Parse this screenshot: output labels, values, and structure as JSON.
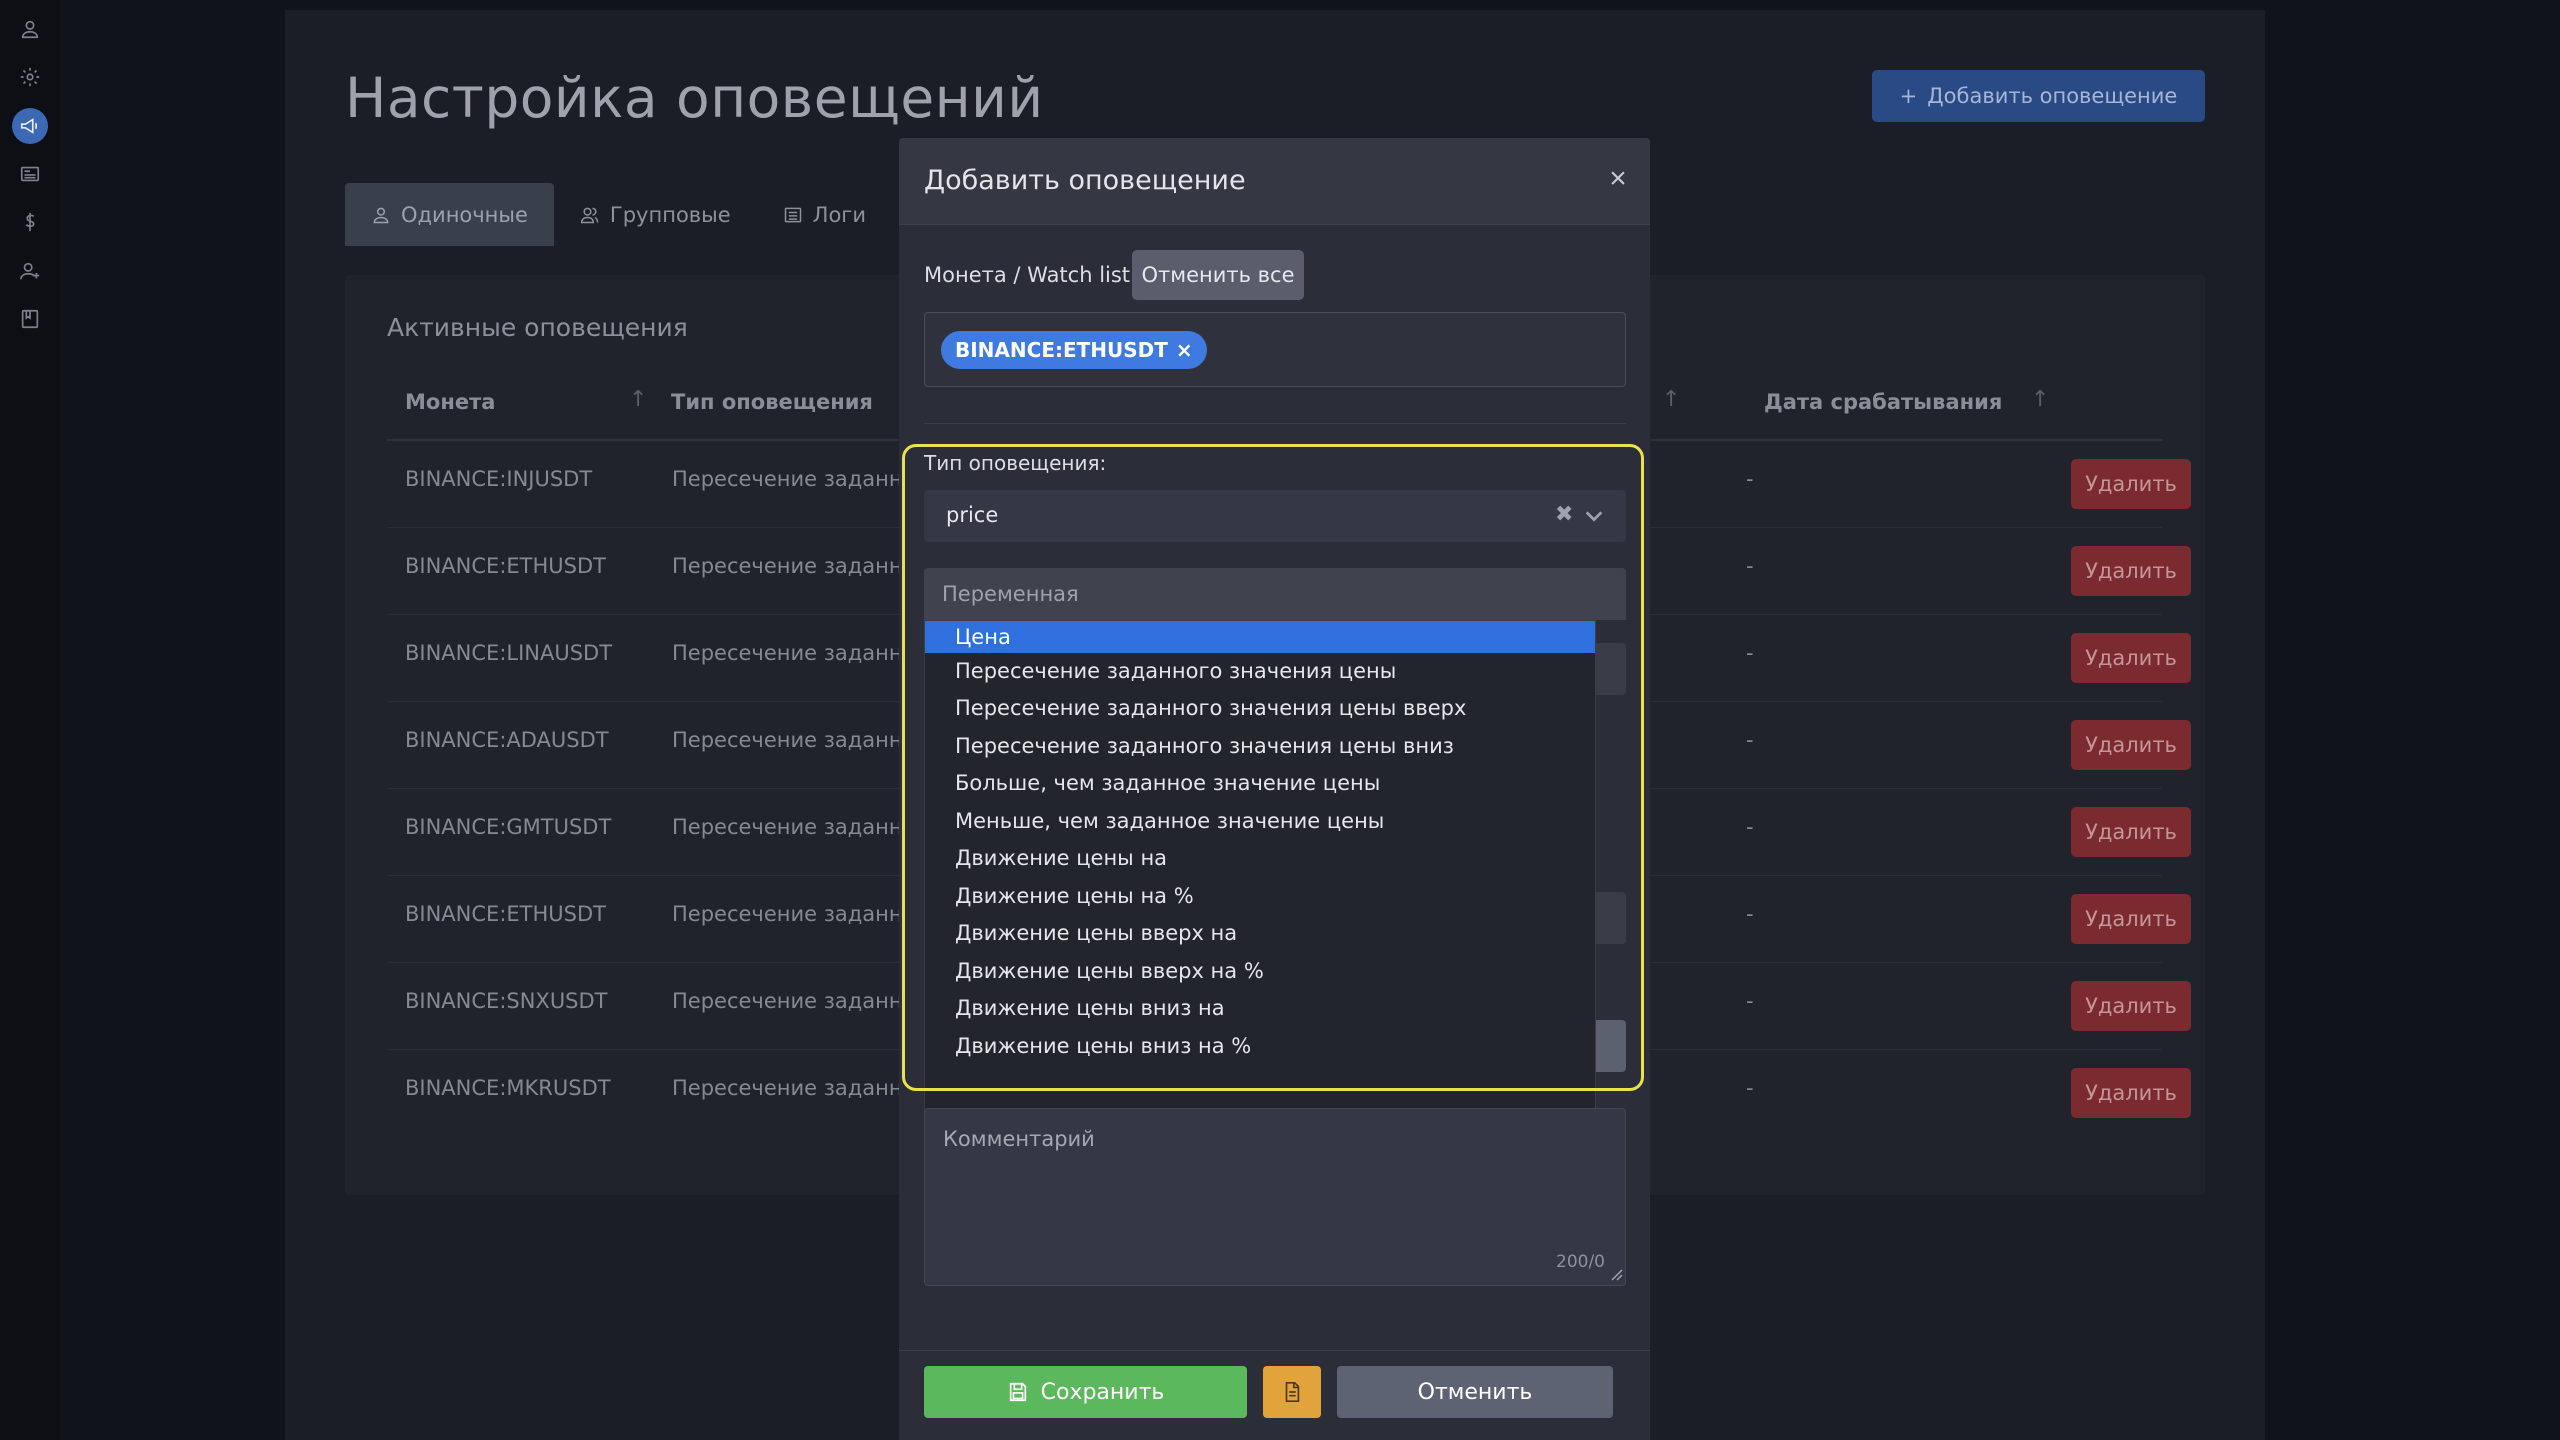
{
  "page": {
    "title": "Настройка оповещений",
    "add_button": "Добавить оповещение",
    "tabs": [
      {
        "label": "Одиночные",
        "icon": "user-icon"
      },
      {
        "label": "Групповые",
        "icon": "users-icon"
      },
      {
        "label": "Логи",
        "icon": "list-icon"
      }
    ],
    "card_title": "Активные оповещения",
    "columns": {
      "coin": "Монета",
      "type": "Тип оповещения",
      "trigger_date": "Дата срабатывания"
    },
    "rows": [
      {
        "coin": "BINANCE:INJUSDT",
        "type": "Пересечение заданно",
        "date": "-",
        "action": "Удалить"
      },
      {
        "coin": "BINANCE:ETHUSDT",
        "type": "Пересечение заданно",
        "date": "-",
        "action": "Удалить"
      },
      {
        "coin": "BINANCE:LINAUSDT",
        "type": "Пересечение заданно",
        "date": "-",
        "action": "Удалить"
      },
      {
        "coin": "BINANCE:ADAUSDT",
        "type": "Пересечение заданно",
        "date": "-",
        "action": "Удалить"
      },
      {
        "coin": "BINANCE:GMTUSDT",
        "type": "Пересечение заданно",
        "date": "-",
        "action": "Удалить"
      },
      {
        "coin": "BINANCE:ETHUSDT",
        "type": "Пересечение заданно",
        "date": "-",
        "action": "Удалить"
      },
      {
        "coin": "BINANCE:SNXUSDT",
        "type": "Пересечение заданно",
        "date": "-",
        "action": "Удалить"
      },
      {
        "coin": "BINANCE:MKRUSDT",
        "type": "Пересечение заданно",
        "date": "-",
        "action": "Удалить"
      }
    ]
  },
  "modal": {
    "title": "Добавить оповещение",
    "close": "×",
    "coin_label": "Монета / Watch list:",
    "cancel_all": "Отменить все",
    "tags": [
      {
        "label": "BINANCE:ETHUSDT",
        "remove": "×"
      }
    ],
    "type_label": "Тип оповещения:",
    "type_value": "price",
    "variable_placeholder": "Переменная",
    "options": [
      "Цена",
      "Пересечение заданного значения цены",
      "Пересечение заданного значения цены вверх",
      "Пересечение заданного значения цены вниз",
      "Больше, чем заданное значение цены",
      "Меньше, чем заданное значение цены",
      "Движение цены на",
      "Движение цены на %",
      "Движение цены вверх на",
      "Движение цены вверх на %",
      "Движение цены вниз на",
      "Движение цены вниз на %"
    ],
    "selected_option_index": 0,
    "comment_placeholder": "Комментарий",
    "comment_counter": "200/0",
    "save": "Сохранить",
    "cancel": "Отменить"
  },
  "colors": {
    "accent": "#2f6fde",
    "tag": "#3f7ae0",
    "save": "#5cb85c",
    "doc": "#e2a33a",
    "delete": "#7b2a30",
    "highlight": "#e9e24a"
  },
  "sidebar_icons": [
    "user-icon",
    "gear-icon",
    "megaphone-icon",
    "news-icon",
    "dollar-icon",
    "user-add-icon",
    "book-icon"
  ]
}
